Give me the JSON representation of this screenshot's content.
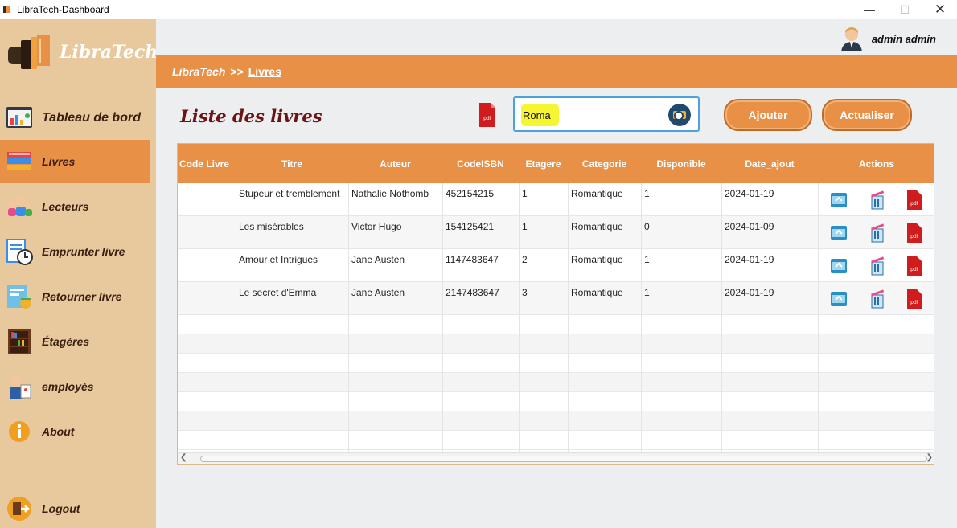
{
  "window": {
    "title": "LibraTech-Dashboard"
  },
  "brand": {
    "name": "LibraTech"
  },
  "sidebar": {
    "items": [
      {
        "label": "Tableau de bord",
        "icon": "dashboard-icon"
      },
      {
        "label": "Livres",
        "icon": "books-icon",
        "active": true
      },
      {
        "label": "Lecteurs",
        "icon": "readers-icon"
      },
      {
        "label": "Emprunter livre",
        "icon": "borrow-icon"
      },
      {
        "label": "Retourner livre",
        "icon": "return-icon"
      },
      {
        "label": "Étagères",
        "icon": "shelves-icon"
      },
      {
        "label": "employés",
        "icon": "employees-icon"
      },
      {
        "label": "About",
        "icon": "info-icon"
      },
      {
        "label": "Logout",
        "icon": "logout-icon"
      }
    ]
  },
  "user": {
    "name": "admin admin"
  },
  "breadcrumb": {
    "root": "LibraTech",
    "sep": ">>",
    "current": "Livres"
  },
  "page": {
    "title": "Liste des livres",
    "search_value": "Roma",
    "add_label": "Ajouter",
    "refresh_label": "Actualiser"
  },
  "table": {
    "columns": [
      "Code Livre",
      "Titre",
      "Auteur",
      "CodeISBN",
      "Etagere",
      "Categorie",
      "Disponible",
      "Date_ajout",
      "Actions"
    ],
    "rows": [
      [
        "",
        "Stupeur et tremblement",
        "Nathalie Nothomb",
        "452154215",
        "1",
        "Romantique",
        "1",
        "2024-01-19"
      ],
      [
        "",
        "Les misérables",
        "Victor Hugo",
        "154125421",
        "1",
        "Romantique",
        "0",
        "2024-01-09"
      ],
      [
        "",
        "Amour et Intrigues",
        "Jane Austen",
        "1147483647",
        "2",
        "Romantique",
        "1",
        "2024-01-19"
      ],
      [
        "",
        "Le secret d'Emma",
        "Jane Austen",
        "2147483647",
        "3",
        "Romantique",
        "1",
        "2024-01-19"
      ]
    ],
    "action_icons": [
      "edit-icon",
      "delete-icon",
      "pdf-icon"
    ]
  },
  "colors": {
    "accent": "#e89046",
    "sidebar": "#e8c99e",
    "title": "#6b1414",
    "pdf": "#d01c1c"
  }
}
